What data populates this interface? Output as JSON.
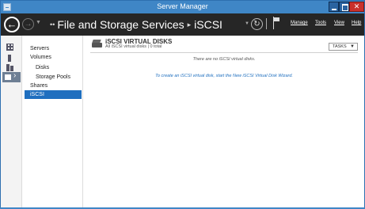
{
  "window": {
    "title": "Server Manager",
    "controls": {
      "minimize": "",
      "maximize": "",
      "close": ""
    }
  },
  "header": {
    "breadcrumb_lead": "••",
    "breadcrumb": [
      "File and Storage Services",
      "iSCSI"
    ],
    "separator": "▸",
    "menu": [
      "Manage",
      "Tools",
      "View",
      "Help"
    ]
  },
  "rail": {
    "icons": [
      "dashboard-icon",
      "local-server-icon",
      "all-servers-icon",
      "file-storage-icon"
    ]
  },
  "nav": {
    "items": [
      {
        "label": "Servers",
        "indent": false,
        "selected": false
      },
      {
        "label": "Volumes",
        "indent": false,
        "selected": false
      },
      {
        "label": "Disks",
        "indent": true,
        "selected": false
      },
      {
        "label": "Storage Pools",
        "indent": true,
        "selected": false
      },
      {
        "label": "Shares",
        "indent": false,
        "selected": false
      },
      {
        "label": "iSCSI",
        "indent": false,
        "selected": true
      }
    ]
  },
  "section": {
    "title": "iSCSI VIRTUAL DISKS",
    "subtitle": "All iSCSI virtual disks | 0 total",
    "tasks_label": "TASKS",
    "empty_message": "There are no iSCSI virtual disks.",
    "wizard_link": "To create an iSCSI virtual disk, start the New iSCSI Virtual Disk Wizard."
  },
  "colors": {
    "titlebar": "#3f86c6",
    "header": "#262626",
    "selected": "#1f6fbf",
    "link": "#1f6fbf"
  }
}
